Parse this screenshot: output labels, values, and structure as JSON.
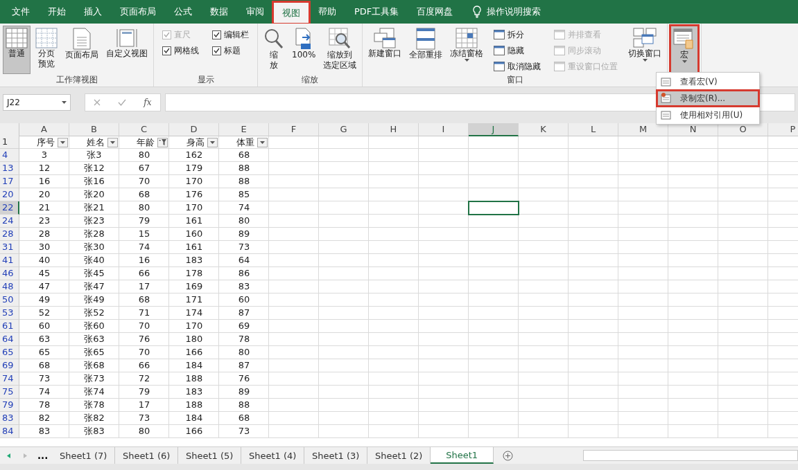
{
  "menu_bar": {
    "tabs": [
      {
        "label": "文件",
        "selected": false,
        "highlighted": false
      },
      {
        "label": "开始",
        "selected": false,
        "highlighted": false
      },
      {
        "label": "插入",
        "selected": false,
        "highlighted": false
      },
      {
        "label": "页面布局",
        "selected": false,
        "highlighted": false
      },
      {
        "label": "公式",
        "selected": false,
        "highlighted": false
      },
      {
        "label": "数据",
        "selected": false,
        "highlighted": false
      },
      {
        "label": "审阅",
        "selected": false,
        "highlighted": false
      },
      {
        "label": "视图",
        "selected": true,
        "highlighted": true
      },
      {
        "label": "帮助",
        "selected": false,
        "highlighted": false
      },
      {
        "label": "PDF工具集",
        "selected": false,
        "highlighted": false
      },
      {
        "label": "百度网盘",
        "selected": false,
        "highlighted": false
      }
    ],
    "search_hint": "操作说明搜索"
  },
  "ribbon": {
    "groups": [
      {
        "label": "工作簿视图",
        "items": [
          {
            "kind": "large",
            "label": "普通",
            "selected": true,
            "highlighted": false,
            "dropdown": false
          },
          {
            "kind": "large",
            "label_lines": [
              "分页",
              "预览"
            ],
            "selected": false,
            "highlighted": false,
            "dropdown": false
          },
          {
            "kind": "large",
            "label": "页面布局",
            "selected": false,
            "highlighted": false,
            "dropdown": false
          },
          {
            "kind": "large",
            "label": "自定义视图",
            "selected": false,
            "highlighted": false,
            "dropdown": false
          }
        ]
      },
      {
        "label": "显示",
        "items": [
          {
            "kind": "stack",
            "children": [
              {
                "kind": "check",
                "label": "直尺",
                "checked": true,
                "disabled": true
              },
              {
                "kind": "check",
                "label": "网格线",
                "checked": true,
                "disabled": false
              }
            ]
          },
          {
            "kind": "stack",
            "children": [
              {
                "kind": "check",
                "label": "编辑栏",
                "checked": true,
                "disabled": false
              },
              {
                "kind": "check",
                "label": "标题",
                "checked": true,
                "disabled": false
              }
            ]
          }
        ]
      },
      {
        "label": "缩放",
        "items": [
          {
            "kind": "large",
            "label_lines": [
              "缩",
              "放"
            ],
            "selected": false,
            "highlighted": false,
            "dropdown": false
          },
          {
            "kind": "large",
            "label": "100%",
            "selected": false,
            "highlighted": false,
            "dropdown": false
          },
          {
            "kind": "large",
            "label_lines": [
              "缩放到",
              "选定区域"
            ],
            "selected": false,
            "highlighted": false,
            "dropdown": false
          }
        ]
      },
      {
        "label": "窗口",
        "items": [
          {
            "kind": "large",
            "label": "新建窗口",
            "selected": false,
            "highlighted": false,
            "dropdown": false
          },
          {
            "kind": "large",
            "label": "全部重排",
            "selected": false,
            "highlighted": false,
            "dropdown": false
          },
          {
            "kind": "large",
            "label": "冻结窗格",
            "selected": false,
            "highlighted": false,
            "dropdown": true
          },
          {
            "kind": "stack",
            "children": [
              {
                "kind": "command",
                "label": "拆分",
                "disabled": false
              },
              {
                "kind": "command",
                "label": "隐藏",
                "disabled": false
              },
              {
                "kind": "command",
                "label": "取消隐藏",
                "disabled": false
              }
            ]
          },
          {
            "kind": "stack",
            "children": [
              {
                "kind": "command",
                "label": "并排查看",
                "disabled": true
              },
              {
                "kind": "command",
                "label": "同步滚动",
                "disabled": true
              },
              {
                "kind": "command",
                "label": "重设窗口位置",
                "disabled": true
              }
            ]
          },
          {
            "kind": "large",
            "label": "切换窗口",
            "selected": false,
            "highlighted": false,
            "dropdown": true
          }
        ]
      },
      {
        "items": [
          {
            "kind": "large",
            "label": "宏",
            "selected": true,
            "highlighted": true,
            "dropdown": true
          }
        ]
      }
    ]
  },
  "macro_menu": [
    {
      "label": "查看宏(V)",
      "selected": false,
      "highlighted": false
    },
    {
      "label": "录制宏(R)...",
      "selected": true,
      "highlighted": true
    },
    {
      "label": "使用相对引用(U)",
      "selected": false,
      "highlighted": false
    }
  ],
  "formula_bar": {
    "name_box": "J22",
    "function_label": "fx"
  },
  "sheet": {
    "columns": [
      {
        "label": "A",
        "selected": false
      },
      {
        "label": "B",
        "selected": false
      },
      {
        "label": "C",
        "selected": false
      },
      {
        "label": "D",
        "selected": false
      },
      {
        "label": "E",
        "selected": false
      },
      {
        "label": "F",
        "selected": false
      },
      {
        "label": "G",
        "selected": false
      },
      {
        "label": "H",
        "selected": false
      },
      {
        "label": "I",
        "selected": false
      },
      {
        "label": "J",
        "selected": true
      },
      {
        "label": "K",
        "selected": false
      },
      {
        "label": "L",
        "selected": false
      },
      {
        "label": "M",
        "selected": false
      },
      {
        "label": "N",
        "selected": false
      },
      {
        "label": "O",
        "selected": false
      },
      {
        "label": "P",
        "selected": false
      }
    ],
    "header_row": {
      "number": "1",
      "cells": [
        {
          "label": "序号",
          "filtered": false
        },
        {
          "label": "姓名",
          "filtered": false
        },
        {
          "label": "年龄",
          "filtered": true
        },
        {
          "label": "身高",
          "filtered": false
        },
        {
          "label": "体重",
          "filtered": false
        }
      ]
    },
    "rows": [
      {
        "number": "4",
        "selected": false,
        "cells": [
          "3",
          "张3",
          "80",
          "162",
          "68"
        ]
      },
      {
        "number": "13",
        "selected": false,
        "cells": [
          "12",
          "张12",
          "67",
          "179",
          "88"
        ]
      },
      {
        "number": "17",
        "selected": false,
        "cells": [
          "16",
          "张16",
          "70",
          "170",
          "88"
        ]
      },
      {
        "number": "20",
        "selected": false,
        "cells": [
          "20",
          "张20",
          "68",
          "176",
          "85"
        ]
      },
      {
        "number": "22",
        "selected": true,
        "cells": [
          "21",
          "张21",
          "80",
          "170",
          "74"
        ]
      },
      {
        "number": "24",
        "selected": false,
        "cells": [
          "23",
          "张23",
          "79",
          "161",
          "80"
        ]
      },
      {
        "number": "28",
        "selected": false,
        "cells": [
          "28",
          "张28",
          "15",
          "160",
          "89"
        ]
      },
      {
        "number": "31",
        "selected": false,
        "cells": [
          "30",
          "张30",
          "74",
          "161",
          "73"
        ]
      },
      {
        "number": "41",
        "selected": false,
        "cells": [
          "40",
          "张40",
          "16",
          "183",
          "64"
        ]
      },
      {
        "number": "46",
        "selected": false,
        "cells": [
          "45",
          "张45",
          "66",
          "178",
          "86"
        ]
      },
      {
        "number": "48",
        "selected": false,
        "cells": [
          "47",
          "张47",
          "17",
          "169",
          "83"
        ]
      },
      {
        "number": "50",
        "selected": false,
        "cells": [
          "49",
          "张49",
          "68",
          "171",
          "60"
        ]
      },
      {
        "number": "53",
        "selected": false,
        "cells": [
          "52",
          "张52",
          "71",
          "174",
          "87"
        ]
      },
      {
        "number": "61",
        "selected": false,
        "cells": [
          "60",
          "张60",
          "70",
          "170",
          "69"
        ]
      },
      {
        "number": "64",
        "selected": false,
        "cells": [
          "63",
          "张63",
          "76",
          "180",
          "78"
        ]
      },
      {
        "number": "65",
        "selected": false,
        "cells": [
          "65",
          "张65",
          "70",
          "166",
          "80"
        ]
      },
      {
        "number": "69",
        "selected": false,
        "cells": [
          "68",
          "张68",
          "66",
          "184",
          "87"
        ]
      },
      {
        "number": "74",
        "selected": false,
        "cells": [
          "73",
          "张73",
          "72",
          "188",
          "76"
        ]
      },
      {
        "number": "75",
        "selected": false,
        "cells": [
          "74",
          "张74",
          "79",
          "183",
          "89"
        ]
      },
      {
        "number": "79",
        "selected": false,
        "cells": [
          "78",
          "张78",
          "17",
          "188",
          "88"
        ]
      },
      {
        "number": "83",
        "selected": false,
        "cells": [
          "82",
          "张82",
          "73",
          "184",
          "68"
        ]
      },
      {
        "number": "84",
        "selected": false,
        "cells": [
          "83",
          "张83",
          "80",
          "166",
          "73"
        ]
      }
    ]
  },
  "sheet_tabs": {
    "more": "...",
    "tabs": [
      {
        "label": "Sheet1 (7)",
        "selected": false
      },
      {
        "label": "Sheet1 (6)",
        "selected": false
      },
      {
        "label": "Sheet1 (5)",
        "selected": false
      },
      {
        "label": "Sheet1 (4)",
        "selected": false
      },
      {
        "label": "Sheet1 (3)",
        "selected": false
      },
      {
        "label": "Sheet1 (2)",
        "selected": false
      },
      {
        "label": "Sheet1",
        "selected": true
      }
    ]
  }
}
